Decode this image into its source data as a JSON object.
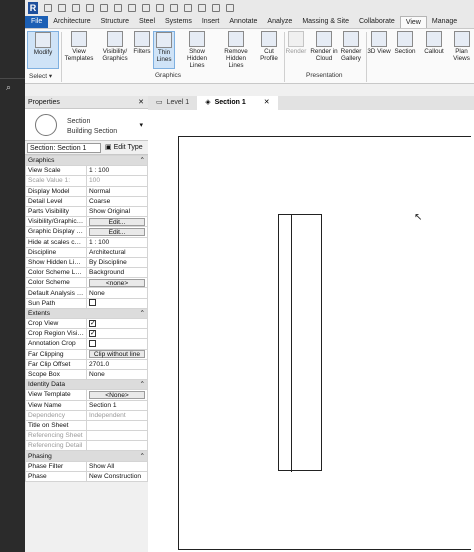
{
  "app": {
    "logo": "R"
  },
  "ribbon_tabs": [
    "File",
    "Architecture",
    "Structure",
    "Steel",
    "Systems",
    "Insert",
    "Annotate",
    "Analyze",
    "Massing & Site",
    "Collaborate",
    "View",
    "Manage"
  ],
  "active_tab": "View",
  "ribbon": {
    "modify": "Modify",
    "select": "Select",
    "view_templates": "View Templates",
    "visibility_graphics": "Visibility/ Graphics",
    "filters": "Filters",
    "thin_lines": "Thin Lines",
    "show_hidden_lines": "Show Hidden Lines",
    "remove_hidden_lines": "Remove Hidden Lines",
    "cut_profile": "Cut Profile",
    "graphics_panel": "Graphics",
    "render": "Render",
    "render_in_cloud": "Render in Cloud",
    "render_gallery": "Render Gallery",
    "view_3d": "3D View",
    "section": "Section",
    "callout": "Callout",
    "plan_views": "Plan Views",
    "presentation_panel": "Presentation"
  },
  "view_tabs": [
    {
      "label": "Level 1"
    },
    {
      "label": "Section 1",
      "active": true
    }
  ],
  "properties": {
    "title": "Properties",
    "type_name": [
      "Section",
      "Building Section"
    ],
    "view_selector": "Section: Section 1",
    "edit_type": "Edit Type",
    "rows": [
      {
        "group": "Graphics"
      },
      {
        "k": "View Scale",
        "v": "1 : 100",
        "box": true
      },
      {
        "k": "Scale Value    1:",
        "v": "100",
        "disabled": true
      },
      {
        "k": "Display Model",
        "v": "Normal"
      },
      {
        "k": "Detail Level",
        "v": "Coarse"
      },
      {
        "k": "Parts Visibility",
        "v": "Show Original"
      },
      {
        "k": "Visibility/Graphics Overrides",
        "v": "Edit...",
        "btn": true
      },
      {
        "k": "Graphic Display Options",
        "v": "Edit...",
        "btn": true
      },
      {
        "k": "Hide at scales coarser than",
        "v": "1 : 100"
      },
      {
        "k": "Discipline",
        "v": "Architectural"
      },
      {
        "k": "Show Hidden Lines",
        "v": "By Discipline"
      },
      {
        "k": "Color Scheme Location",
        "v": "Background"
      },
      {
        "k": "Color Scheme",
        "v": "<none>",
        "btn": true
      },
      {
        "k": "Default Analysis Display Style",
        "v": "None"
      },
      {
        "k": "Sun Path",
        "check": false
      },
      {
        "group": "Extents"
      },
      {
        "k": "Crop View",
        "check": true
      },
      {
        "k": "Crop Region Visible",
        "check": true
      },
      {
        "k": "Annotation Crop",
        "check": false
      },
      {
        "k": "Far Clipping",
        "v": "Clip without line",
        "btn": true
      },
      {
        "k": "Far Clip Offset",
        "v": "2701.0"
      },
      {
        "k": "Scope Box",
        "v": "None"
      },
      {
        "group": "Identity Data"
      },
      {
        "k": "View Template",
        "v": "<None>",
        "btn": true
      },
      {
        "k": "View Name",
        "v": "Section 1"
      },
      {
        "k": "Dependency",
        "v": "Independent",
        "disabled": true
      },
      {
        "k": "Title on Sheet",
        "v": ""
      },
      {
        "k": "Referencing Sheet",
        "v": "",
        "disabled": true
      },
      {
        "k": "Referencing Detail",
        "v": "",
        "disabled": true
      },
      {
        "group": "Phasing"
      },
      {
        "k": "Phase Filter",
        "v": "Show All"
      },
      {
        "k": "Phase",
        "v": "New Construction"
      }
    ]
  }
}
